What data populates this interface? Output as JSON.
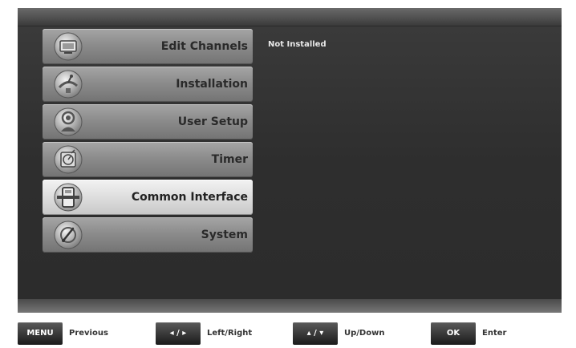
{
  "menu": {
    "items": [
      {
        "label": "Edit Channels",
        "icon": "edit-channels-icon",
        "selected": false
      },
      {
        "label": "Installation",
        "icon": "installation-icon",
        "selected": false
      },
      {
        "label": "User Setup",
        "icon": "user-setup-icon",
        "selected": false
      },
      {
        "label": "Timer",
        "icon": "timer-icon",
        "selected": false
      },
      {
        "label": "Common Interface",
        "icon": "common-interface-icon",
        "selected": true
      },
      {
        "label": "System",
        "icon": "system-icon",
        "selected": false
      }
    ]
  },
  "detail": {
    "status": "Not Installed"
  },
  "keys": [
    {
      "button": "MENU",
      "description": "Previous"
    },
    {
      "button": "◂ / ▸",
      "description": "Left/Right"
    },
    {
      "button": "▴ / ▾",
      "description": "Up/Down"
    },
    {
      "button": "OK",
      "description": "Enter"
    }
  ],
  "colors": {
    "panel_background": "#333333",
    "menu_item": "#8c8c8c",
    "menu_item_selected": "#dedede",
    "status_text": "#e8e8e8",
    "key_button": "#2a2a2a"
  }
}
